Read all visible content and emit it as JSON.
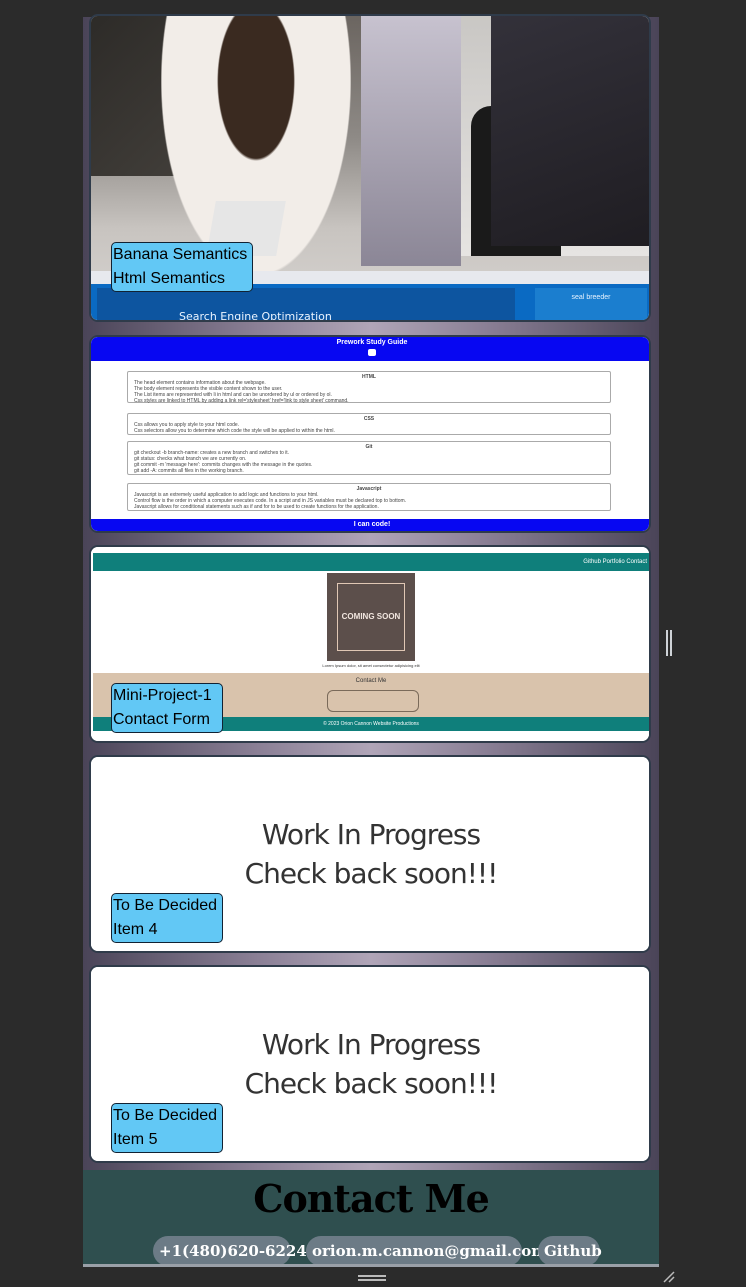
{
  "projects": [
    {
      "line1": "Banana Semantics",
      "line2": "Html Semantics"
    },
    {
      "line1": "",
      "line2": ""
    },
    {
      "line1": "Mini-Project-1",
      "line2": "Contact Form"
    },
    {
      "line1": "To Be Decided",
      "line2": "Item 4"
    },
    {
      "line1": "To Be Decided",
      "line2": "Item 5"
    }
  ],
  "card1": {
    "band_text": "Search Engine Optimization",
    "band_box_text": "seal breeder"
  },
  "study_guide": {
    "title": "Prework Study Guide",
    "footer": "I can code!",
    "sections": [
      {
        "title": "HTML",
        "lines": [
          "The head element contains information about the webpage.",
          "The body element represents the visible content shown to the user.",
          "The List items are represented with li in html and can be unordered by ul or ordered by ol.",
          "Css styles are linked to HTML by adding a link rel='stylesheet' href='link to style sheet' command."
        ]
      },
      {
        "title": "CSS",
        "lines": [
          "Css allows you to apply style to your html code.",
          "Css selectors allow you to determine which code the style will be applied to within the html."
        ]
      },
      {
        "title": "Git",
        "lines": [
          "git checkout -b branch-name: creates a new branch and switches to it.",
          "git status: checks what branch we are currently on.",
          "git commit -m 'message here': commits changes with the message in the quotes.",
          "git add -A: commits all files in the working branch."
        ]
      },
      {
        "title": "Javascript",
        "lines": [
          "Javascript is an extremely useful application to add logic and functions to your html.",
          "Control flow is the order in which a computer executes code. In a script and in JS variables must be declared top to bottom.",
          "Javascript allows for conditional statements such as if and for to be used to create functions for the application."
        ]
      }
    ]
  },
  "mini_project": {
    "nav": "Github   Portfolio   Contact",
    "image_text": "COMING SOON",
    "caption": "Lorem Ipsum dolor, sit amet consectetur adipisicing elit",
    "contact_title": "Contact Me",
    "footer": "© 2023 Orion Cannon Website Productions"
  },
  "wip": {
    "line1": "Work In Progress",
    "line2": "Check back soon!!!"
  },
  "contact": {
    "title": "Contact Me",
    "phone": "+1(480)620-6224",
    "email": "orion.m.cannon@gmail.com",
    "github": "Github"
  }
}
